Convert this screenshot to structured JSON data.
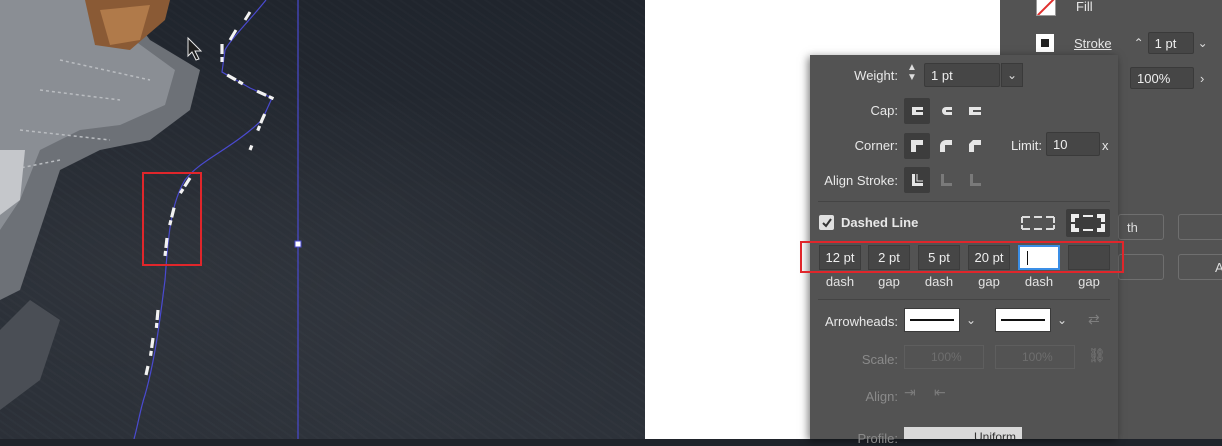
{
  "right_panel": {
    "fill_label": "Fill",
    "stroke_label": "Stroke",
    "stroke_weight": "1 pt",
    "opacity": "100%",
    "partial_button_1": "th",
    "partial_button_2": "A"
  },
  "stroke_panel": {
    "weight_label": "Weight:",
    "weight_value": "1 pt",
    "cap_label": "Cap:",
    "corner_label": "Corner:",
    "limit_label": "Limit:",
    "limit_value": "10",
    "limit_unit": "x",
    "align_stroke_label": "Align Stroke:",
    "dashed_line_label": "Dashed Line",
    "dashed_line_checked": true,
    "dash_values": [
      "12 pt",
      "2 pt",
      "5 pt",
      "20 pt",
      "",
      ""
    ],
    "dash_captions": [
      "dash",
      "gap",
      "dash",
      "gap",
      "dash",
      "gap"
    ],
    "arrowheads_label": "Arrowheads:",
    "scale_label": "Scale:",
    "scale_value_1": "100%",
    "scale_value_2": "100%",
    "align_label": "Align:",
    "profile_label": "Profile:",
    "profile_value": "Uniform"
  },
  "colors": {
    "panel_bg": "#535353",
    "highlight_red": "#e0262b",
    "path_blue": "#4a4ad0"
  }
}
